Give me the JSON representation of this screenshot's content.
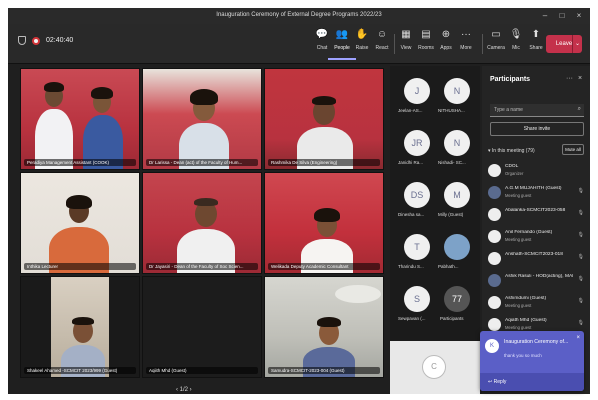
{
  "window": {
    "title": "Inauguration Ceremony of External Degree Programs 2022/23",
    "minimize": "–",
    "maximize": "□",
    "close": "×"
  },
  "toolbar": {
    "timer": "02:40:40",
    "buttons": [
      {
        "label": "Chat",
        "icon": "💬"
      },
      {
        "label": "People",
        "icon": "👥"
      },
      {
        "label": "Raise",
        "icon": "✋"
      },
      {
        "label": "React",
        "icon": "☺"
      },
      {
        "label": "View",
        "icon": "▦"
      },
      {
        "label": "Rooms",
        "icon": "▤"
      },
      {
        "label": "Apps",
        "icon": "⊕"
      },
      {
        "label": "More",
        "icon": "···"
      },
      {
        "label": "Camera",
        "icon": "▭"
      },
      {
        "label": "Mic",
        "icon": "🎙"
      },
      {
        "label": "Share",
        "icon": "⬆"
      }
    ],
    "leave_label": "Leave",
    "leave_caret": "⌄"
  },
  "stage": {
    "tiles": [
      {
        "name": "Peradiya Management Assistant (COOK)"
      },
      {
        "name": "Dr Larissa - Dean (act) of the Faculty of Hum..."
      },
      {
        "name": "Rashmika De Silva (Engineering)"
      },
      {
        "name": "Inthika Lecturer"
      },
      {
        "name": "Dr Jayasiri - Dean of the Faculty of Soc Scien..."
      },
      {
        "name": "Welikada Deputy Academic Consultant"
      },
      {
        "name": "Shakeel Ahamed -SCMCIT 2023/999 (Guest)"
      },
      {
        "name": "Aqiith Mhd (Guest)"
      },
      {
        "name": "Samudra-SCMCIT-2023-004 (Guest)"
      }
    ],
    "pager": "‹  1/2  ›"
  },
  "strip": {
    "avatars": [
      {
        "initials": "J",
        "name": "Jeelan-AS..."
      },
      {
        "initials": "N",
        "name": "NITHUSHA..."
      },
      {
        "initials": "JR",
        "name": "Janidhi Ra..."
      },
      {
        "initials": "N",
        "name": "Nishadi- SC..."
      },
      {
        "initials": "DS",
        "name": "Dinesha sa..."
      },
      {
        "initials": "M",
        "name": "Milly (Guest)"
      },
      {
        "initials": "T",
        "name": "Tharindu S..."
      },
      {
        "initials": "",
        "name": "Pabhath..."
      },
      {
        "initials": "S",
        "name": "Sewpavan (..."
      },
      {
        "initials": "77",
        "name": "Participants"
      }
    ],
    "bottom_initials": "C"
  },
  "panel": {
    "title": "Participants",
    "more": "···",
    "close": "×",
    "search_placeholder": "Type a name",
    "share_invite": "Share invite",
    "in_meeting": "▾ In this meeting (79)",
    "mute_all": "Mute all",
    "participants": [
      {
        "name": "CDOL",
        "role": "Organizer",
        "avatar": "C"
      },
      {
        "name": "A.G.M MUJAHITH (Guest)",
        "role": "Meeting guest",
        "avatar": "A"
      },
      {
        "name": "Abalanka-SCMCIT2023-058",
        "role": "",
        "avatar": "A"
      },
      {
        "name": "Anil Fernando (Guest)",
        "role": "Meeting guest",
        "avatar": "A"
      },
      {
        "name": "Anshath-SCMCIT2023-018",
        "role": "",
        "avatar": "A"
      },
      {
        "name": "Ashik Rasuli - HOD(acting), MAI (...",
        "role": "",
        "avatar": "A"
      },
      {
        "name": "Ashimdumi (Guest)",
        "role": "Meeting guest",
        "avatar": "A"
      },
      {
        "name": "Aqiath Mhd (Guest)",
        "role": "Meeting guest",
        "avatar": "A"
      }
    ]
  },
  "toast": {
    "title": "Inauguration Ceremony of...",
    "subtitle": "thank you so much",
    "avatar": "K",
    "close": "×",
    "reply": "↩  Reply"
  }
}
